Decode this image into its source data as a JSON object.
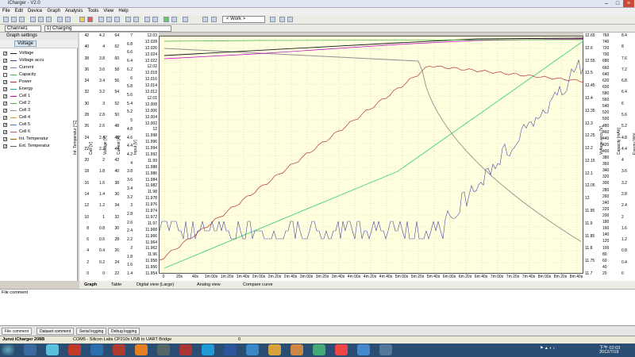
{
  "window": {
    "title": "iCharger - V2.0"
  },
  "menu": [
    "File",
    "Edit",
    "Device",
    "Graph",
    "Analysis",
    "Tools",
    "View",
    "Help"
  ],
  "toolbar": {
    "work_label": "< Work >"
  },
  "channel": {
    "channel": "Channel1",
    "program": "1) Charging"
  },
  "left_panel": {
    "header": "Graph settings",
    "active_series": "Voltage",
    "series": [
      {
        "label": "Voltage",
        "checked": true,
        "color": "#1a1a1a"
      },
      {
        "label": "Voltage accu",
        "checked": true,
        "color": "#4040a0"
      },
      {
        "label": "Current",
        "checked": true,
        "color": "#7a7ad0"
      },
      {
        "label": "Capacity",
        "checked": false,
        "color": "#30c060"
      },
      {
        "label": "Power",
        "checked": true,
        "color": "#b03030"
      },
      {
        "label": "Energy",
        "checked": true,
        "color": "#20a8a8"
      },
      {
        "label": "Cell 1",
        "checked": true,
        "color": "#c000c0"
      },
      {
        "label": "Cell 2",
        "checked": true,
        "color": "#40b040"
      },
      {
        "label": "Cell 3",
        "checked": true,
        "color": "#909090"
      },
      {
        "label": "Cell 4",
        "checked": true,
        "color": "#d0a020"
      },
      {
        "label": "Cell 5",
        "checked": true,
        "color": "#3080d0"
      },
      {
        "label": "Cell 6",
        "checked": true,
        "color": "#d05050"
      },
      {
        "label": "Int. Temperatur",
        "checked": true,
        "color": "#a06000"
      },
      {
        "label": "Ext. Temperatur",
        "checked": true,
        "color": "#606060"
      }
    ]
  },
  "axes": {
    "int_temp": {
      "label": "Int. Temperatur [°C]",
      "ticks": [
        "42",
        "40",
        "38",
        "36",
        "34",
        "32",
        "30",
        "28",
        "26",
        "24",
        "22",
        "20",
        "18",
        "16",
        "14",
        "12",
        "10",
        "8",
        "6",
        "4",
        "2",
        "0"
      ]
    },
    "cell": {
      "label": "Cell [V]",
      "ticks": [
        "4.2",
        "4",
        "3.8",
        "3.6",
        "3.4",
        "3.2",
        "3",
        "2.8",
        "2.6",
        "2.4",
        "2.2",
        "2",
        "1.8",
        "1.6",
        "1.4",
        "1.2",
        "1",
        "0.8",
        "0.6",
        "0.4",
        "0.2",
        "0"
      ]
    },
    "voltage": {
      "label": "Voltage [V]",
      "ticks": [
        "64",
        "62",
        "60",
        "58",
        "56",
        "54",
        "52",
        "50",
        "48",
        "46",
        "44",
        "42",
        "40",
        "38",
        "36",
        "34",
        "32",
        "30",
        "28",
        "26",
        "24",
        "22"
      ]
    },
    "current": {
      "label": "Current [A]",
      "ticks": [
        "7",
        "6.8",
        "6.6",
        "6.4",
        "6.2",
        "6",
        "5.8",
        "5.6",
        "5.4",
        "5.2",
        "5",
        "4.8",
        "4.6",
        "4.4",
        "4.2",
        "4",
        "3.8",
        "3.6",
        "3.4",
        "3.2",
        "3",
        "2.8",
        "2.6",
        "2.4",
        "2.2",
        "2",
        "1.8",
        "1.6",
        "1.4"
      ]
    },
    "input": {
      "label": "Input [V]",
      "ticks": [
        "12.03",
        "12.028",
        "12.026",
        "12.024",
        "12.022",
        "12.02",
        "12.018",
        "12.016",
        "12.014",
        "12.012",
        "12.01",
        "12.008",
        "12.006",
        "12.004",
        "12.002",
        "12",
        "11.998",
        "11.996",
        "11.994",
        "11.992",
        "11.99",
        "11.988",
        "11.986",
        "11.984",
        "11.982",
        "11.98",
        "11.978",
        "11.976",
        "11.974",
        "11.972",
        "11.97",
        "11.968",
        "11.966",
        "11.964",
        "11.962",
        "11.96",
        "11.958",
        "11.956",
        "11.954"
      ]
    },
    "voltage_accu": {
      "label": "Voltage accu [V]",
      "ticks": [
        "12.65",
        "12.6",
        "12.55",
        "12.5",
        "12.45",
        "12.4",
        "12.35",
        "12.3",
        "12.25",
        "12.2",
        "12.15",
        "12.1",
        "12.05",
        "12",
        "11.95",
        "11.9",
        "11.85",
        "11.8",
        "11.75",
        "11.7"
      ]
    },
    "capacity": {
      "label": "Capacity [mAh]",
      "ticks": [
        "760",
        "740",
        "720",
        "700",
        "680",
        "660",
        "640",
        "620",
        "600",
        "580",
        "560",
        "540",
        "520",
        "500",
        "480",
        "460",
        "440",
        "420",
        "400",
        "380",
        "360",
        "340",
        "320",
        "300",
        "280",
        "260",
        "240",
        "220",
        "200",
        "180",
        "160",
        "140",
        "120",
        "100",
        "80",
        "60",
        "40",
        "20"
      ]
    },
    "energy": {
      "label": "Energy [Wh]",
      "ticks": [
        "8.4",
        "8",
        "7.6",
        "7.2",
        "6.8",
        "6.4",
        "6",
        "5.6",
        "5.2",
        "4.8",
        "4.4",
        "4",
        "3.6",
        "3.2",
        "2.8",
        "2.4",
        "2",
        "1.6",
        "1.2",
        "0.8",
        "0.4",
        "0"
      ]
    },
    "time_ticks": [
      "0",
      "20s",
      "40s",
      "1m 00s",
      "1m 20s",
      "1m 40s",
      "2m 00s",
      "2m 20s",
      "2m 40s",
      "3m 00s",
      "3m 20s",
      "3m 40s",
      "4m 00s",
      "4m 20s",
      "4m 40s",
      "5m 00s",
      "5m 20s",
      "5m 40s",
      "6m 00s",
      "6m 20s",
      "6m 40s",
      "7m 00s",
      "7m 20s",
      "7m 40s",
      "8m 00s",
      "8m 20s",
      "8m 40s"
    ]
  },
  "bottom_view_tabs": [
    "Graph",
    "Table",
    "Digital view (Large)",
    "Analog view",
    "Compare curve"
  ],
  "file_comment": {
    "header": "File comment"
  },
  "bottom_tabs": [
    "File comment",
    "Dataset comment",
    "Serial logging",
    "Debug logging"
  ],
  "status": {
    "device": "Junsi iCharger 208B",
    "port": "COM5 - Silicon Labs CP210x USB to UART Bridge",
    "value": "0"
  },
  "clock": {
    "time": "下午 02:03",
    "date": "2012/7/19"
  },
  "colors": {
    "plot_bg": "#ffffe0",
    "taskbar": "#2a4d74"
  }
}
